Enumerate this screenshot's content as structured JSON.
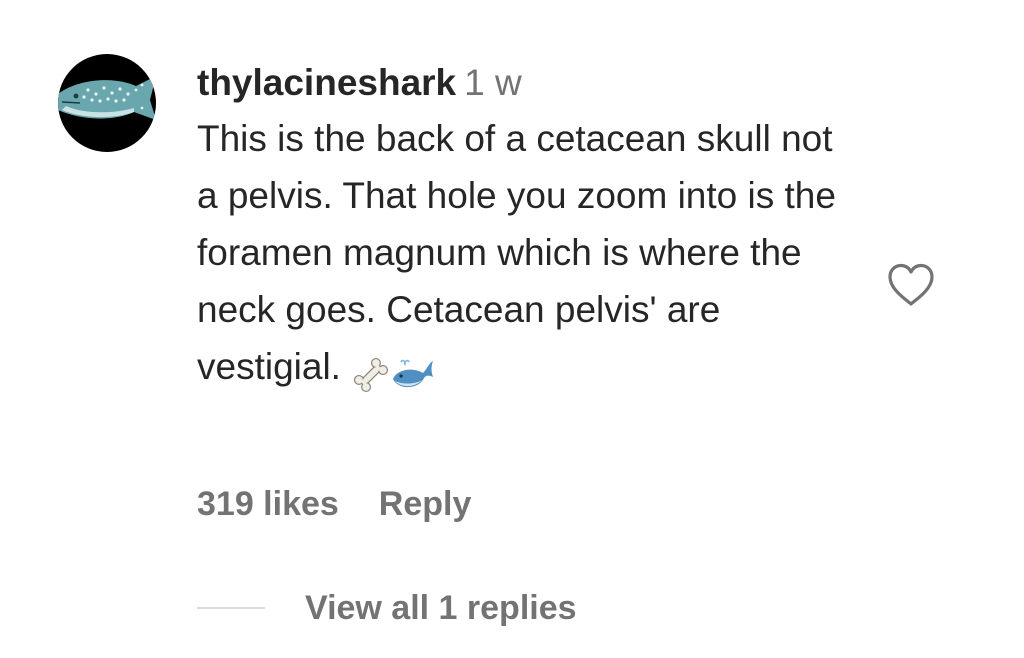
{
  "comment": {
    "username": "thylacineshark",
    "timestamp": "1 w",
    "text": "This is the back of a cetacean skull not a pelvis. That hole you zoom into is the foramen magnum which is where the neck goes. Cetacean pelvis' are vestigial.",
    "emojis": [
      "bone-emoji",
      "whale-emoji"
    ],
    "likes": "319 likes",
    "reply_label": "Reply",
    "view_replies_label": "View all 1 replies",
    "avatar_icon": "whale-shark-avatar",
    "like_icon": "heart-outline-icon"
  },
  "colors": {
    "primary_text": "#262626",
    "secondary_text": "#737373",
    "divider": "#dbdbdb",
    "avatar_bg": "#000000",
    "avatar_shark": "#6aa6ad"
  }
}
